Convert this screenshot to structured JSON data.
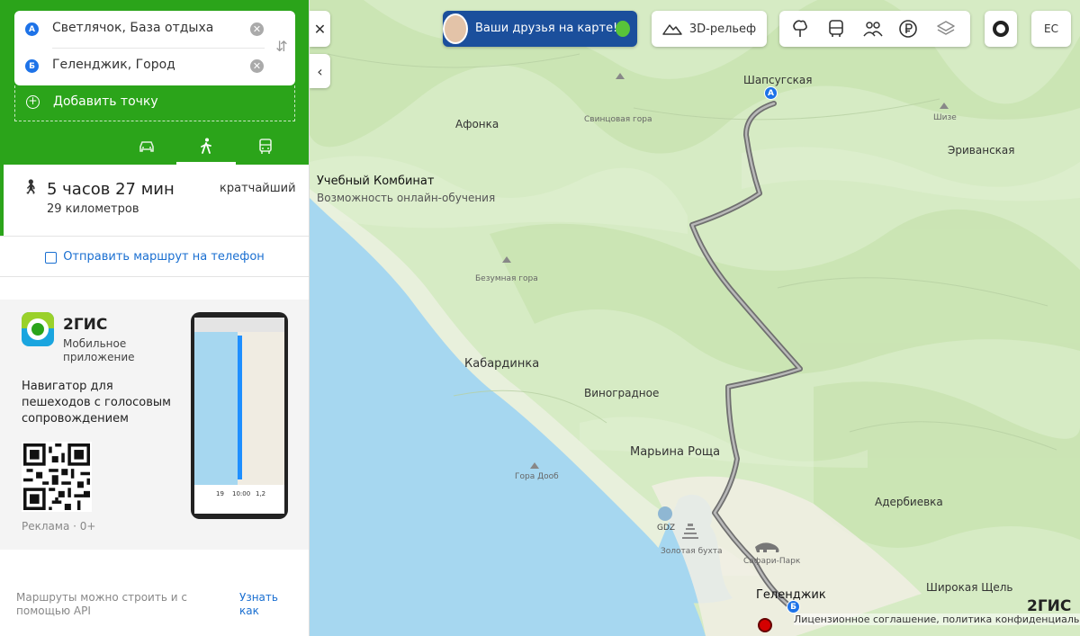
{
  "route": {
    "from": "Светлячок, База отдыха",
    "to": "Геленджик, Город",
    "badge_a": "А",
    "badge_b": "Б",
    "add_point": "Добавить точку"
  },
  "modes": [
    {
      "name": "car",
      "icon": "car-icon"
    },
    {
      "name": "walk",
      "icon": "pedestrian-icon",
      "active": true
    },
    {
      "name": "transit",
      "icon": "bus-icon"
    }
  ],
  "result": {
    "time": "5 часов 27 мин",
    "distance": "29 километров",
    "tag": "кратчайший"
  },
  "send_to_phone": "Отправить маршрут на телефон",
  "ad": {
    "title": "2ГИС",
    "subtitle": "Мобильное приложение",
    "description": "Навигатор для пешеходов с голосовым сопровождением",
    "label": "Реклама · 0+",
    "phone_stats": [
      "19",
      "10:00",
      "1,2"
    ]
  },
  "api_note": "Маршруты можно строить и с помощью API",
  "api_link": "Узнать как",
  "toolbar": {
    "friends": "Ваши друзья на карте!",
    "relief": "3D-рельеф",
    "user_initials": "ЕС"
  },
  "map": {
    "labels": {
      "shapsug": "Шапсугская",
      "afonka": "Афонка",
      "svintsova": "Свинцовая гора",
      "shize": "Шизе",
      "erivanskaya": "Эриванская",
      "kombinat": "Учебный Комбинат",
      "kombinat_sub": "Возможность онлайн-обучения",
      "bezumnaya": "Безумная гора",
      "kabardinka": "Кабардинка",
      "vinogradnoe": "Виноградное",
      "marina": "Марьина Роща",
      "dooob": "Гора Дооб",
      "gdz": "GDZ",
      "zolotaya": "Золотая бухта",
      "safari": "Сафари-Парк",
      "gelendzhik": "Геленджик",
      "adrebievka": "Адербиевка",
      "shirokaya": "Широкая Щель"
    },
    "attribution": "Лицензионное соглашение, политика конфиденциальности",
    "brand": "2ГИС",
    "colors": {
      "route": "#7a7a7a",
      "sea": "#a6d7f0",
      "forest": "#cfe7b7",
      "pin": "#1e73e8"
    }
  }
}
